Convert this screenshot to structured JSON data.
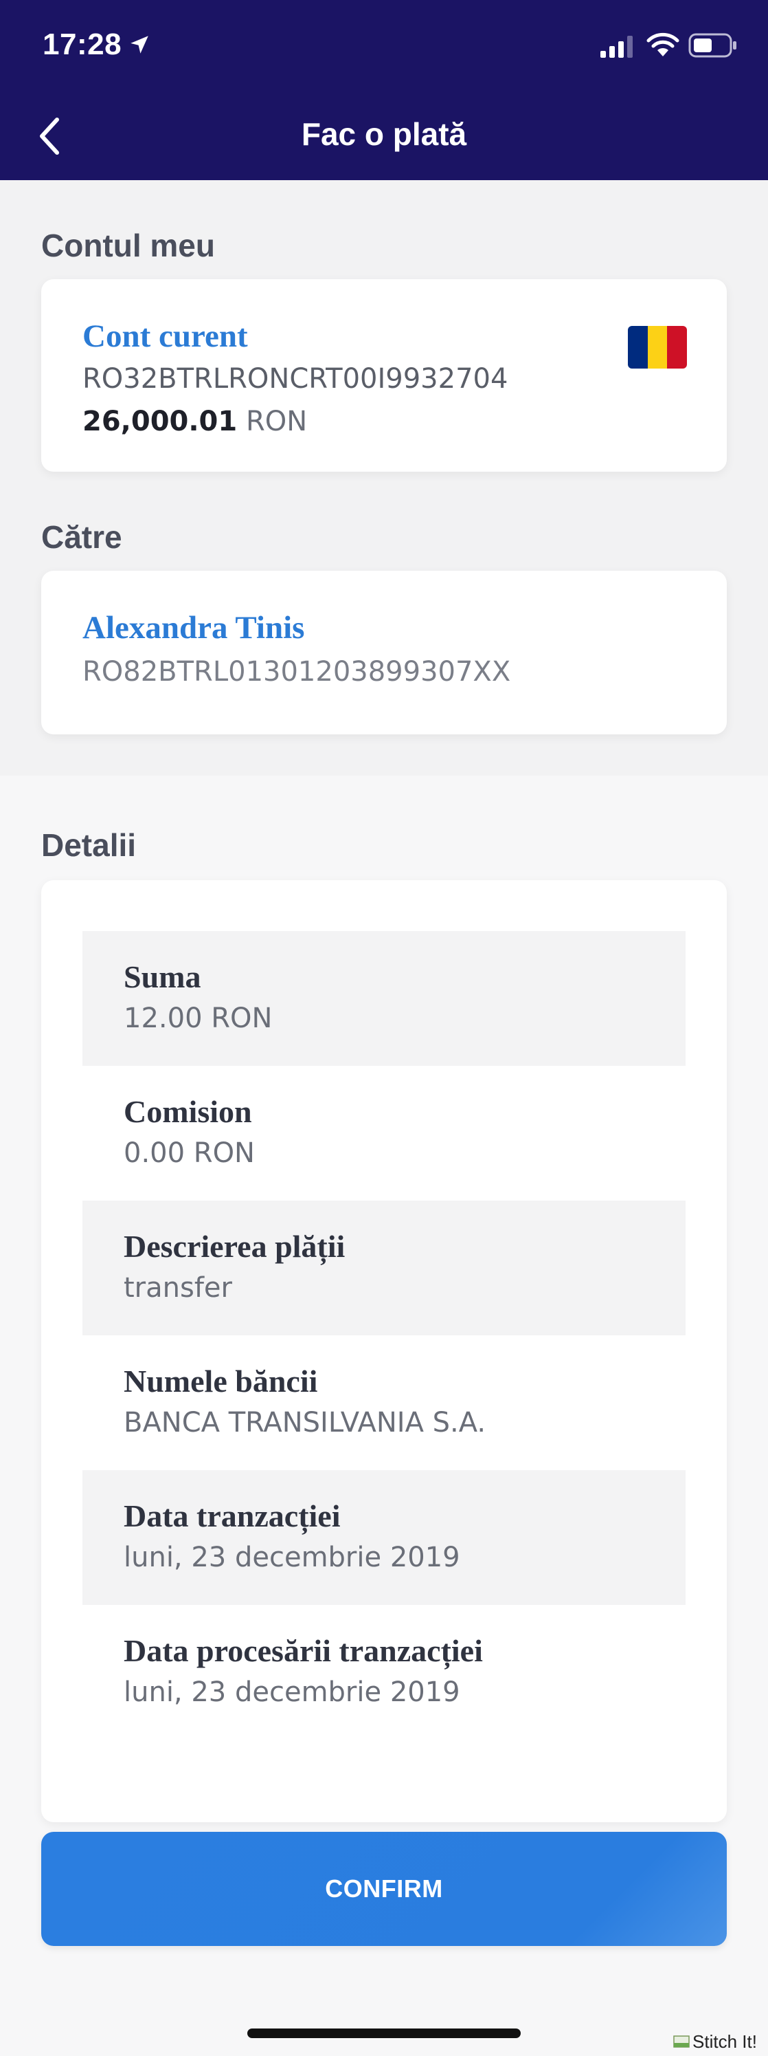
{
  "status_bar": {
    "time": "17:28"
  },
  "header": {
    "title": "Fac o plată"
  },
  "my_account": {
    "section_label": "Contul meu",
    "account_name": "Cont curent",
    "iban": "RO32BTRLRONCRT00I9932704",
    "balance": "26,000.01",
    "currency": "RON",
    "flag_colors": [
      "#002B7F",
      "#FCD116",
      "#CE1126"
    ]
  },
  "recipient": {
    "section_label": "Către",
    "name": "Alexandra Tinis",
    "iban": "RO82BTRL01301203899307XX"
  },
  "details": {
    "section_label": "Detalii",
    "rows": [
      {
        "label": "Suma",
        "value": "12.00 RON"
      },
      {
        "label": "Comision",
        "value": "0.00 RON"
      },
      {
        "label": "Descrierea plății",
        "value": "transfer"
      },
      {
        "label": "Numele băncii",
        "value": "BANCA TRANSILVANIA S.A."
      },
      {
        "label": "Data tranzacției",
        "value": "luni, 23 decembrie 2019"
      },
      {
        "label": "Data procesării tranzacției",
        "value": "luni, 23 decembrie 2019"
      }
    ]
  },
  "actions": {
    "confirm_label": "CONFIRM"
  },
  "watermark": {
    "text": "Stitch It!"
  },
  "colors": {
    "header_bg": "#1b1464",
    "accent": "#2b7bd5",
    "button": "#2b7ee0"
  }
}
